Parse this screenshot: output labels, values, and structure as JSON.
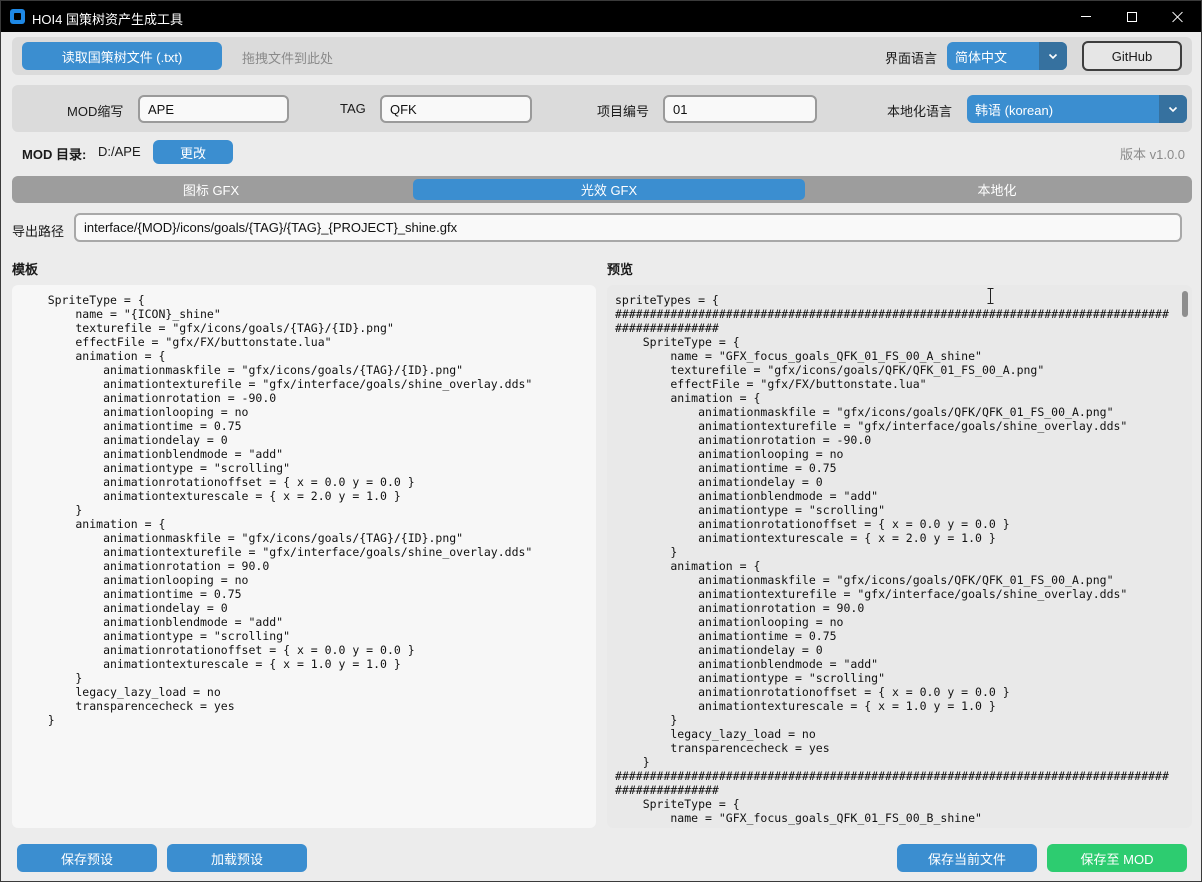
{
  "window": {
    "title": "HOI4 国策树资产生成工具"
  },
  "top_bar": {
    "open_file_label": "读取国策树文件 (.txt)",
    "drop_hint": "拖拽文件到此处",
    "ui_language_label": "界面语言",
    "ui_language_value": "简体中文",
    "github_label": "GitHub"
  },
  "settings": {
    "mod_id_label": "MOD缩写",
    "mod_id_value": "APE",
    "tag_label": "TAG",
    "tag_value": "QFK",
    "project_label": "项目编号",
    "project_value": "01",
    "loc_language_label": "本地化语言",
    "loc_language_value": "韩语 (korean)"
  },
  "mod_dir": {
    "label": "MOD 目录:",
    "value": "D:/APE",
    "change_label": "更改",
    "version": "版本 v1.0.0"
  },
  "tabs": [
    {
      "label": "图标 GFX",
      "active": false
    },
    {
      "label": "光效 GFX",
      "active": true
    },
    {
      "label": "本地化",
      "active": false
    }
  ],
  "export": {
    "label": "导出路径",
    "value": "interface/{MOD}/icons/goals/{TAG}/{TAG}_{PROJECT}_shine.gfx"
  },
  "template": {
    "heading": "模板",
    "code": "    SpriteType = {\n        name = \"{ICON}_shine\"\n        texturefile = \"gfx/icons/goals/{TAG}/{ID}.png\"\n        effectFile = \"gfx/FX/buttonstate.lua\"\n        animation = {\n            animationmaskfile = \"gfx/icons/goals/{TAG}/{ID}.png\"\n            animationtexturefile = \"gfx/interface/goals/shine_overlay.dds\"\n            animationrotation = -90.0\n            animationlooping = no\n            animationtime = 0.75\n            animationdelay = 0\n            animationblendmode = \"add\"\n            animationtype = \"scrolling\"\n            animationrotationoffset = { x = 0.0 y = 0.0 }\n            animationtexturescale = { x = 2.0 y = 1.0 }\n        }\n        animation = {\n            animationmaskfile = \"gfx/icons/goals/{TAG}/{ID}.png\"\n            animationtexturefile = \"gfx/interface/goals/shine_overlay.dds\"\n            animationrotation = 90.0\n            animationlooping = no\n            animationtime = 0.75\n            animationdelay = 0\n            animationblendmode = \"add\"\n            animationtype = \"scrolling\"\n            animationrotationoffset = { x = 0.0 y = 0.0 }\n            animationtexturescale = { x = 1.0 y = 1.0 }\n        }\n        legacy_lazy_load = no\n        transparencecheck = yes\n    }"
  },
  "preview": {
    "heading": "预览",
    "code": "spriteTypes = {\n################################################################################\n###############\n    SpriteType = {\n        name = \"GFX_focus_goals_QFK_01_FS_00_A_shine\"\n        texturefile = \"gfx/icons/goals/QFK/QFK_01_FS_00_A.png\"\n        effectFile = \"gfx/FX/buttonstate.lua\"\n        animation = {\n            animationmaskfile = \"gfx/icons/goals/QFK/QFK_01_FS_00_A.png\"\n            animationtexturefile = \"gfx/interface/goals/shine_overlay.dds\"\n            animationrotation = -90.0\n            animationlooping = no\n            animationtime = 0.75\n            animationdelay = 0\n            animationblendmode = \"add\"\n            animationtype = \"scrolling\"\n            animationrotationoffset = { x = 0.0 y = 0.0 }\n            animationtexturescale = { x = 2.0 y = 1.0 }\n        }\n        animation = {\n            animationmaskfile = \"gfx/icons/goals/QFK/QFK_01_FS_00_A.png\"\n            animationtexturefile = \"gfx/interface/goals/shine_overlay.dds\"\n            animationrotation = 90.0\n            animationlooping = no\n            animationtime = 0.75\n            animationdelay = 0\n            animationblendmode = \"add\"\n            animationtype = \"scrolling\"\n            animationrotationoffset = { x = 0.0 y = 0.0 }\n            animationtexturescale = { x = 1.0 y = 1.0 }\n        }\n        legacy_lazy_load = no\n        transparencecheck = yes\n    }\n################################################################################\n###############\n    SpriteType = {\n        name = \"GFX_focus_goals_QFK_01_FS_00_B_shine\""
  },
  "footer": {
    "save_preset_label": "保存预设",
    "load_preset_label": "加载预设",
    "save_current_label": "保存当前文件",
    "save_to_mod_label": "保存至 MOD"
  },
  "icons": {
    "app": "app-icon",
    "minimize": "minimize-icon",
    "maximize": "maximize-icon",
    "close": "close-icon",
    "dropdown": "chevron-down-icon",
    "cursor": "text-cursor-icon"
  },
  "colors": {
    "accent": "#3b8ed0",
    "accent_dark": "#36719f",
    "success": "#2dcc70",
    "panel": "#dbdbdb",
    "background": "#ececec",
    "tab_track": "#9d9d9d"
  }
}
